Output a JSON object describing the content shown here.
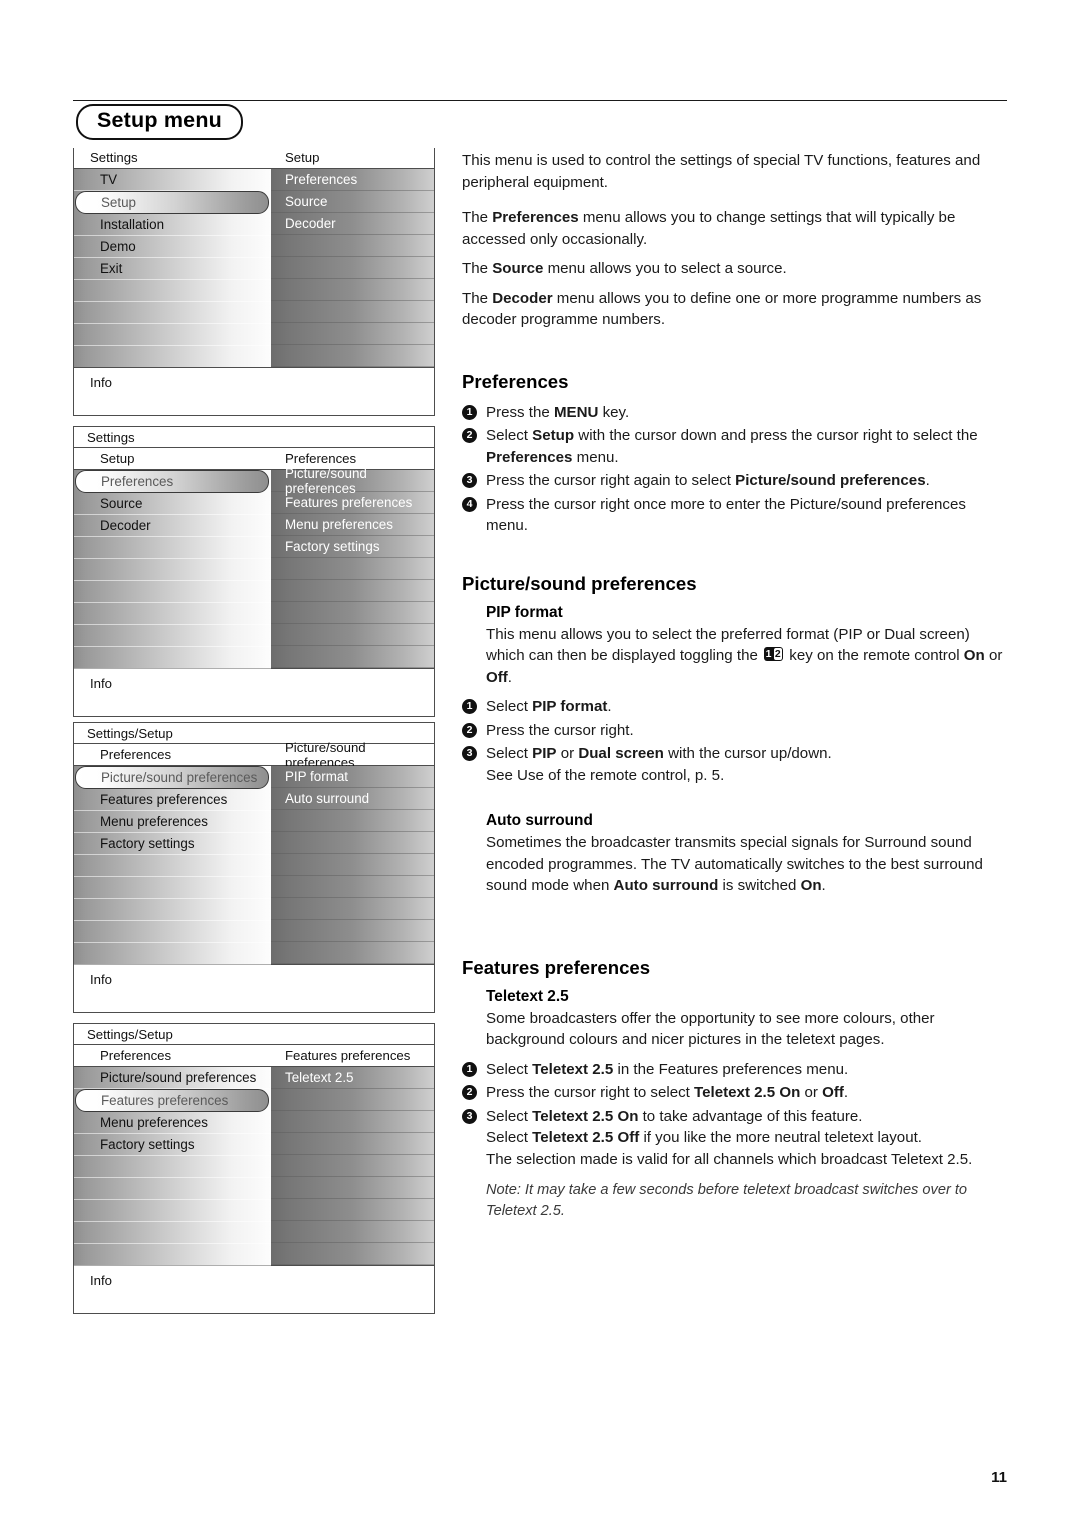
{
  "page": {
    "title": "Setup menu",
    "number": "11"
  },
  "osd_panels": [
    {
      "name": "panel-setup",
      "framed": false,
      "breadcrumb": null,
      "caption_left": "Settings",
      "caption_right": "Setup",
      "left_items": [
        "TV",
        "Setup",
        "Installation",
        "Demo",
        "Exit"
      ],
      "left_selected_index": 1,
      "right_items": [
        "Preferences",
        "Source",
        "Decoder"
      ],
      "right_selected_index": null,
      "info_label": "Info"
    },
    {
      "name": "panel-preferences",
      "framed": true,
      "breadcrumb": "Settings",
      "caption_left": "Setup",
      "caption_right": "Preferences",
      "left_items": [
        "Preferences",
        "Source",
        "Decoder"
      ],
      "left_selected_index": 0,
      "right_items": [
        "Picture/sound preferences",
        "Features preferences",
        "Menu preferences",
        "Factory settings"
      ],
      "right_selected_index": null,
      "info_label": "Info"
    },
    {
      "name": "panel-picture-sound-preferences",
      "framed": true,
      "breadcrumb": "Settings/Setup",
      "caption_left": "Preferences",
      "caption_right": "Picture/sound preferences",
      "left_items": [
        "Picture/sound preferences",
        "Features preferences",
        "Menu preferences",
        "Factory settings"
      ],
      "left_selected_index": 0,
      "right_items": [
        "PIP format",
        "Auto surround"
      ],
      "right_selected_index": null,
      "info_label": "Info"
    },
    {
      "name": "panel-features-preferences",
      "framed": true,
      "breadcrumb": "Settings/Setup",
      "caption_left": "Preferences",
      "caption_right": "Features preferences",
      "left_items": [
        "Picture/sound preferences",
        "Features preferences",
        "Menu preferences",
        "Factory settings"
      ],
      "left_selected_index": 1,
      "right_items": [
        "Teletext 2.5"
      ],
      "right_selected_index": null,
      "info_label": "Info"
    }
  ],
  "prose": {
    "intro": "This menu is used to control the settings of special TV functions, features and peripheral equipment.",
    "preferences_desc_pre": "The ",
    "preferences_desc_bold": "Preferences",
    "preferences_desc_post": " menu allows you to change settings that will typically be accessed only occasionally.",
    "source_desc_pre": "The ",
    "source_desc_bold": "Source",
    "source_desc_post": " menu allows you to select a source.",
    "decoder_desc_pre": "The ",
    "decoder_desc_bold": "Decoder",
    "decoder_desc_post": " menu allows you to define one or more programme numbers as decoder programme numbers.",
    "preferences_heading": "Preferences",
    "pref_steps": [
      {
        "n": "1",
        "pre": "Press the ",
        "bold": "MENU",
        "post": " key."
      },
      {
        "n": "2",
        "pre": "Select ",
        "bold": "Setup",
        "post": " with the cursor down and press the cursor right to select the ",
        "bold2": "Preferences",
        "post2": " menu."
      },
      {
        "n": "3",
        "pre": "Press the cursor right again to select ",
        "bold": "Picture/sound preferences",
        "post": "."
      },
      {
        "n": "4",
        "pre": "Press the cursor right once more to enter the Picture/sound preferences menu.",
        "bold": "",
        "post": ""
      }
    ],
    "picture_sound_heading": "Picture/sound preferences",
    "pip_heading": "PIP format",
    "pip_desc_a": "This menu allows you to select the preferred format (PIP or Dual screen) which can then be displayed toggling the ",
    "pip_key_glyph": "12",
    "pip_desc_b": " key on the remote control ",
    "pip_desc_on": "On",
    "pip_desc_or": " or ",
    "pip_desc_off": "Off",
    "pip_desc_end": ".",
    "pip_steps": [
      {
        "n": "1",
        "pre": "Select ",
        "bold": "PIP format",
        "post": "."
      },
      {
        "n": "2",
        "pre": "Press the cursor right.",
        "bold": "",
        "post": ""
      },
      {
        "n": "3",
        "pre": "Select ",
        "bold": "PIP",
        "mid": " or ",
        "bold2": "Dual screen",
        "post": " with the cursor up/down.",
        "extra": "See Use of the remote control, p. 5."
      }
    ],
    "auto_surround_heading": "Auto surround",
    "auto_surround_pre": "Sometimes the broadcaster transmits special signals for Surround sound encoded programmes. The TV automatically switches to the best surround sound mode when ",
    "auto_surround_bold": "Auto surround",
    "auto_surround_mid": " is switched ",
    "auto_surround_bold2": "On",
    "auto_surround_post": ".",
    "features_heading": "Features preferences",
    "teletext_heading": "Teletext 2.5",
    "teletext_desc": "Some broadcasters offer the opportunity to see more colours, other background colours and nicer pictures in the teletext pages.",
    "teletext_steps": [
      {
        "n": "1",
        "pre": "Select ",
        "bold": "Teletext 2.5",
        "post": " in the Features preferences menu."
      },
      {
        "n": "2",
        "pre": "Press the cursor right to select ",
        "bold": "Teletext 2.5 On",
        "mid": " or ",
        "bold2": "Off",
        "post": "."
      },
      {
        "n": "3",
        "pre": "Select ",
        "bold": "Teletext 2.5 On",
        "post": " to take advantage of this feature.",
        "line2_pre": "Select ",
        "line2_bold": "Teletext 2.5 Off",
        "line2_post": " if you like the more neutral teletext layout.",
        "line3": "The selection made is valid for all channels which broadcast Teletext 2.5."
      }
    ],
    "teletext_note": "Note: It may take a few seconds before teletext broadcast switches over to Teletext 2.5."
  }
}
